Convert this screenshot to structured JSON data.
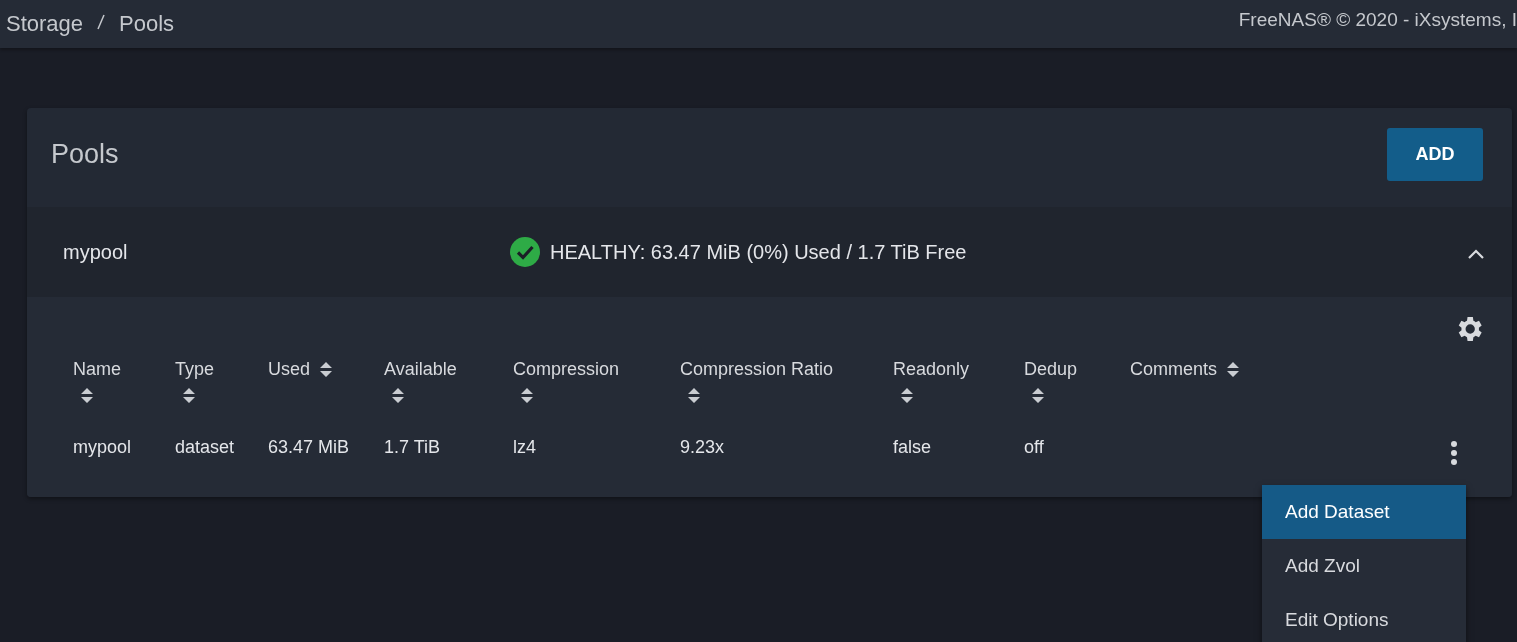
{
  "breadcrumb": [
    "Storage",
    "Pools"
  ],
  "copyright": "FreeNAS® © 2020 - iXsystems, I",
  "card": {
    "title": "Pools",
    "add_button": "ADD"
  },
  "pool": {
    "name": "mypool",
    "healthy": true,
    "status": "HEALTHY: 63.47 MiB (0%) Used / 1.7 TiB Free",
    "expanded": true
  },
  "table": {
    "columns": [
      "Name",
      "Type",
      "Used",
      "Available",
      "Compression",
      "Compression Ratio",
      "Readonly",
      "Dedup",
      "Comments"
    ],
    "rows": [
      [
        "mypool",
        "dataset",
        "63.47 MiB",
        "1.7 TiB",
        "lz4",
        "9.23x",
        "false",
        "off",
        ""
      ]
    ]
  },
  "menu": [
    {
      "label": "Add Dataset",
      "selected": true
    },
    {
      "label": "Add Zvol",
      "selected": false
    },
    {
      "label": "Edit Options",
      "selected": false
    }
  ]
}
